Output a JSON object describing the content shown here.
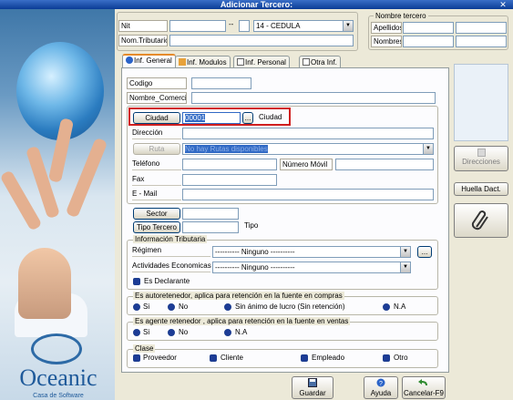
{
  "window": {
    "title": "Adicionar Tercero:",
    "close_glyph": "✕"
  },
  "header": {
    "nit_label": "Nit",
    "nit_value": "",
    "dash": "--",
    "dv_value": "",
    "doc_type": "14 - CEDULA",
    "nom_tributario_label": "Nom.Tributario",
    "nom_tributario_value": "",
    "nombre_group": "Nombre tercero",
    "apellidos_label": "Apellidos",
    "nombres_label": "Nombres"
  },
  "tabs": [
    {
      "label": "Inf. General",
      "icon": "info-icon"
    },
    {
      "label": "Inf. Modulos",
      "icon": "grid-icon"
    },
    {
      "label": "Inf. Personal",
      "icon": "document-icon"
    },
    {
      "label": "Otra Inf.",
      "icon": "document-icon"
    }
  ],
  "general": {
    "codigo_label": "Codigo",
    "nombre_comercial_label": "Nombre_Comercial",
    "ciudad_button": "Ciudad",
    "ciudad_value": "00001",
    "ciudad_ellipsis": "...",
    "ciudad_name": "Ciudad",
    "direccion_label": "Dirección",
    "ruta_button": "Ruta",
    "ruta_value": "No hay Rutas disponibles",
    "telefono_label": "Teléfono",
    "numero_movil_label": "Número Móvil",
    "fax_label": "Fax",
    "email_label": "E - Mail",
    "sector_button": "Sector",
    "tipo_tercero_button": "Tipo Tercero",
    "tipo_label": "Tipo"
  },
  "tributaria": {
    "title": "Información Tributaria",
    "regimen_label": "Régimen",
    "regimen_value": "---------- Ninguno ----------",
    "regimen_ellipsis": "...",
    "actividades_label": "Actividades Economicas",
    "actividades_value": "---------- Ninguno ----------",
    "declarante_label": "Es Declarante"
  },
  "autorretenedor": {
    "title": "Es autoretenedor, aplica para retención en la fuente en compras",
    "options": [
      "Si",
      "No",
      "Sin ánimo de lucro (Sin retención)",
      "N.A"
    ]
  },
  "agente": {
    "title": "Es agente retenedor , aplica para retención en la fuente en ventas",
    "options": [
      "Si",
      "No",
      "N.A"
    ]
  },
  "clase": {
    "title": "Clase",
    "options": [
      "Proveedor",
      "Cliente",
      "Empleado",
      "Otro"
    ]
  },
  "right_panel": {
    "direcciones_button": "Direcciones",
    "huella_button": "Huella Dact."
  },
  "footer": {
    "guardar": "Guardar",
    "ayuda": "Ayuda",
    "cancelar": "Cancelar-F9"
  },
  "brand": {
    "name": "Oceanic",
    "tagline": "Casa de Software"
  },
  "colors": {
    "highlight_border": "#d01f1f",
    "selection": "#316ac5",
    "title_bar": "#0b3c96"
  }
}
